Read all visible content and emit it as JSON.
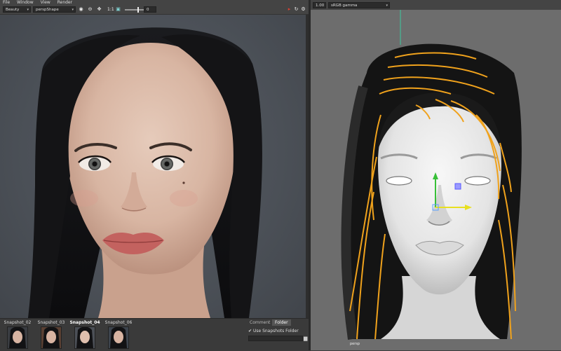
{
  "menu": [
    "File",
    "Window",
    "View",
    "Render"
  ],
  "render_toolbar": {
    "layer_combo": "Beauty",
    "camera_combo": "perspShape",
    "ratio_label": "1:1",
    "exposure_value": "0"
  },
  "snapshots": [
    {
      "label": "Snapshot_02",
      "active": false
    },
    {
      "label": "Snapshot_03",
      "active": false
    },
    {
      "label": "Snapshot_04",
      "active": true
    },
    {
      "label": "Snapshot_06",
      "active": false
    }
  ],
  "snapshot_panel": {
    "tabs": [
      "Comment",
      "Folder"
    ],
    "active_tab": "Folder",
    "use_folder_label": "Use Snapshots Folder",
    "use_folder_checked": true
  },
  "viewport_toolbar": {
    "gamma_value": "1.00",
    "color_space": "sRGB gamma"
  },
  "viewport": {
    "camera_label": "persp"
  },
  "colors": {
    "guide_curves": "#f0a21c",
    "manipulator_y": "#38c038",
    "manipulator_x": "#e8e020",
    "manipulator_z": "#5a5aff",
    "stop_render": "#e04030"
  }
}
